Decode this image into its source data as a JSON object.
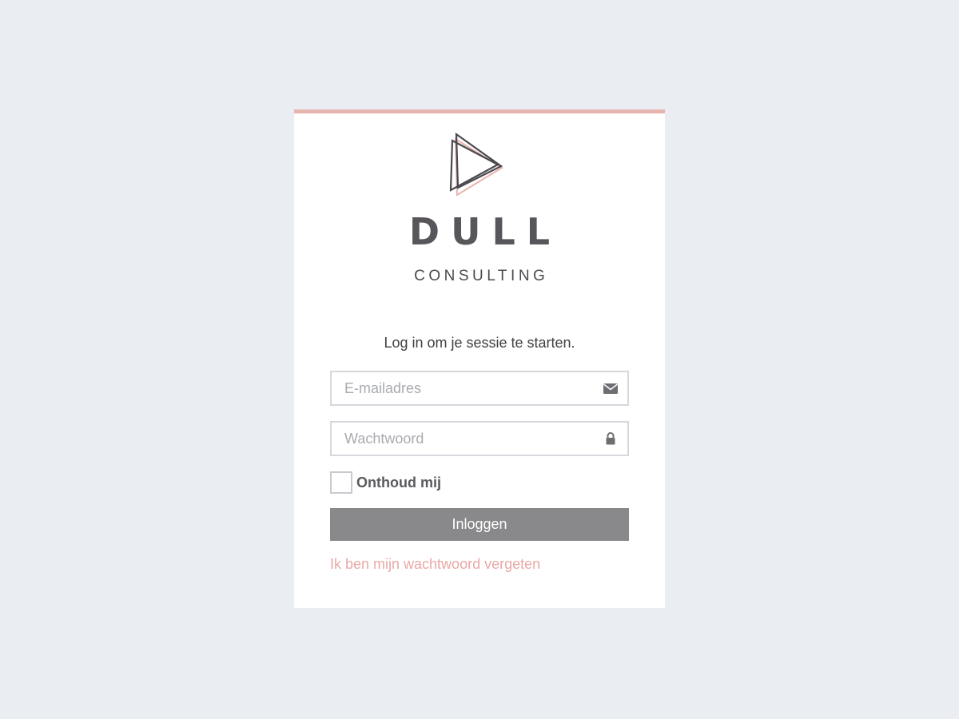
{
  "brand": {
    "name": "DULL",
    "tagline": "CONSULTING",
    "logo_icon": "triangle-play-logo-icon"
  },
  "login": {
    "intro": "Log in om je sessie te starten.",
    "email": {
      "placeholder": "E-mailadres",
      "value": "",
      "icon": "envelope-icon"
    },
    "password": {
      "placeholder": "Wachtwoord",
      "value": "",
      "icon": "lock-icon"
    },
    "remember_label": "Onthoud mij",
    "remember_checked": false,
    "submit_label": "Inloggen",
    "forgot_link": "Ik ben mijn wachtwoord vergeten"
  },
  "colors": {
    "background": "#eaeef3",
    "card": "#ffffff",
    "accent": "#e8b4b0",
    "button": "#89898b",
    "brand_text": "#58565b",
    "link": "#e8aaa5"
  }
}
